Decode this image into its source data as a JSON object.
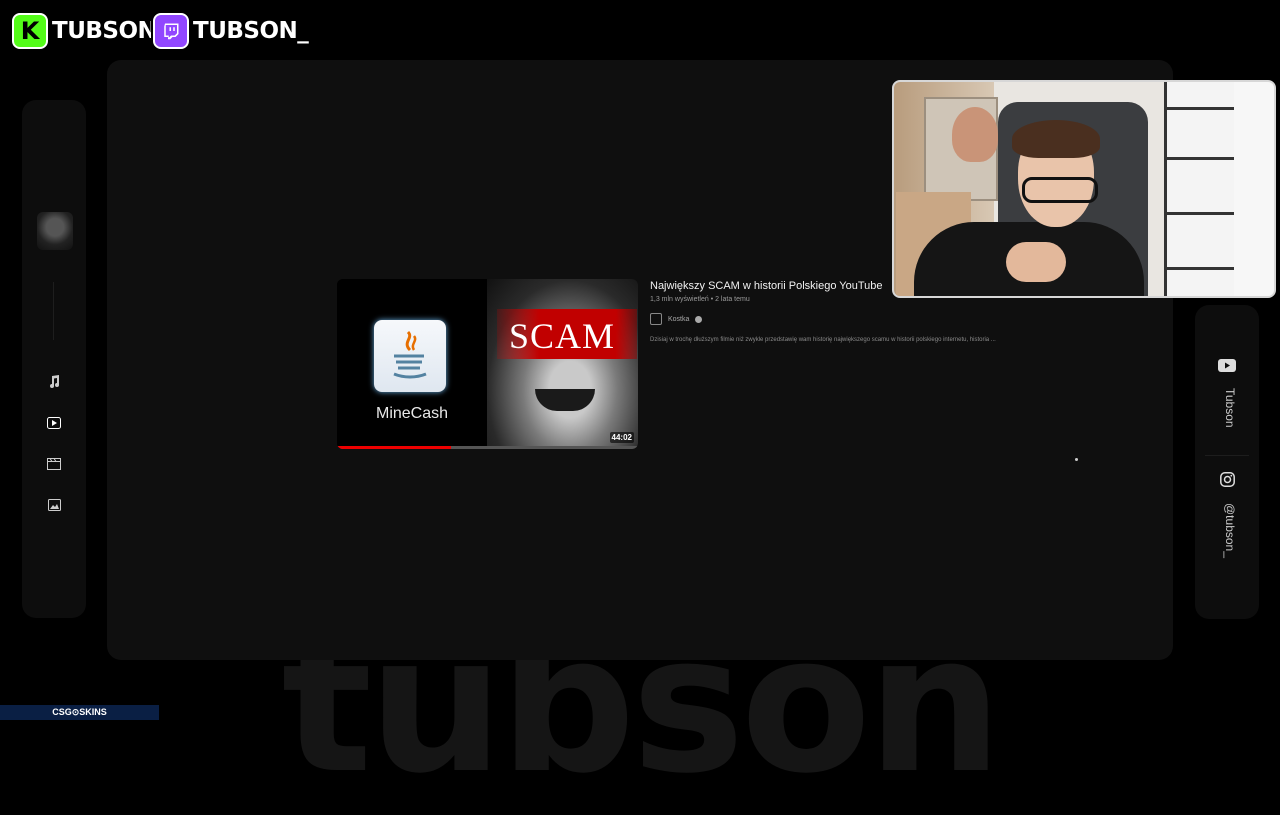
{
  "platforms": {
    "kick": {
      "logo_letter": "K",
      "name": "TUBSON",
      "color": "#53fc18"
    },
    "twitch": {
      "name": "TUBSON_",
      "color": "#9146ff"
    }
  },
  "background_word": "tubson",
  "sidebar": {
    "icons": [
      "music-icon",
      "play-icon",
      "clapperboard-icon",
      "image-icon"
    ],
    "active": "play-icon"
  },
  "video": {
    "title": "Największy SCAM w historii Polskiego YouTube",
    "stats": "1,3 mln wyświetleń • 2 lata temu",
    "channel": "Kostka",
    "description": "Dzisiaj w trochę dłuższym filmie niż zwykle przedstawię wam historię największego scamu w historii polskiego internetu, historia ...",
    "duration": "44:02",
    "watched_fraction": 0.38,
    "thumbnail": {
      "left_label": "MineCash",
      "right_label": "SCAM"
    }
  },
  "socials": [
    {
      "icon": "youtube-icon",
      "handle": "Tubson"
    },
    {
      "icon": "instagram-icon",
      "handle": "@tubson_"
    }
  ],
  "sponsor": {
    "label": "CSG⊙SKINS"
  }
}
